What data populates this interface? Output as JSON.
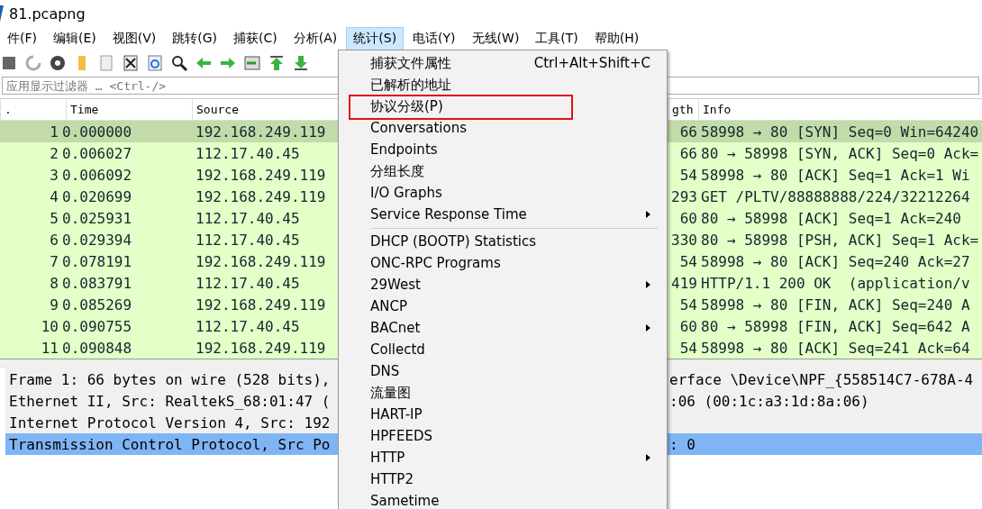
{
  "window": {
    "title": "81.pcapng"
  },
  "menu_bar": [
    {
      "label": "件(F)",
      "selected": false
    },
    {
      "label": "编辑(E)",
      "selected": false
    },
    {
      "label": "视图(V)",
      "selected": false
    },
    {
      "label": "跳转(G)",
      "selected": false
    },
    {
      "label": "捕获(C)",
      "selected": false
    },
    {
      "label": "分析(A)",
      "selected": false
    },
    {
      "label": "统计(S)",
      "selected": true
    },
    {
      "label": "电话(Y)",
      "selected": false
    },
    {
      "label": "无线(W)",
      "selected": false
    },
    {
      "label": "工具(T)",
      "selected": false
    },
    {
      "label": "帮助(H)",
      "selected": false
    }
  ],
  "filter": {
    "placeholder": "应用显示过滤器 … <Ctrl-/>"
  },
  "packet_list": {
    "columns": [
      ".",
      "Time",
      "Source",
      "gth",
      "Info"
    ],
    "rows": [
      {
        "no": "1",
        "time": "0.000000",
        "source": "192.168.249.119",
        "length": "66",
        "info": "58998 → 80 [SYN] Seq=0 Win=64240",
        "selected": true
      },
      {
        "no": "2",
        "time": "0.006027",
        "source": "112.17.40.45",
        "length": "66",
        "info": "80 → 58998 [SYN, ACK] Seq=0 Ack=",
        "selected": false
      },
      {
        "no": "3",
        "time": "0.006092",
        "source": "192.168.249.119",
        "length": "54",
        "info": "58998 → 80 [ACK] Seq=1 Ack=1 Wi",
        "selected": false
      },
      {
        "no": "4",
        "time": "0.020699",
        "source": "192.168.249.119",
        "length": "293",
        "info": "GET /PLTV/88888888/224/32212264",
        "selected": false
      },
      {
        "no": "5",
        "time": "0.025931",
        "source": "112.17.40.45",
        "length": "60",
        "info": "80 → 58998 [ACK] Seq=1 Ack=240 ",
        "selected": false
      },
      {
        "no": "6",
        "time": "0.029394",
        "source": "112.17.40.45",
        "length": "330",
        "info": "80 → 58998 [PSH, ACK] Seq=1 Ack=",
        "selected": false
      },
      {
        "no": "7",
        "time": "0.078191",
        "source": "192.168.249.119",
        "length": "54",
        "info": "58998 → 80 [ACK] Seq=240 Ack=27",
        "selected": false
      },
      {
        "no": "8",
        "time": "0.083791",
        "source": "112.17.40.45",
        "length": "419",
        "info": "HTTP/1.1 200 OK  (application/v",
        "selected": false
      },
      {
        "no": "9",
        "time": "0.085269",
        "source": "192.168.249.119",
        "length": "54",
        "info": "58998 → 80 [FIN, ACK] Seq=240 A",
        "selected": false
      },
      {
        "no": "10",
        "time": "0.090755",
        "source": "112.17.40.45",
        "length": "60",
        "info": "80 → 58998 [FIN, ACK] Seq=642 A",
        "selected": false
      },
      {
        "no": "11",
        "time": "0.090848",
        "source": "192.168.249.119",
        "length": "54",
        "info": "58998 → 80 [ACK] Seq=241 Ack=64",
        "selected": false
      }
    ]
  },
  "details": [
    {
      "left": "Frame 1: 66 bytes on wire (528 bits),",
      "right": "erface \\Device\\NPF_{558514C7-678A-4",
      "selected": false
    },
    {
      "left": "Ethernet II, Src: RealtekS_68:01:47 (",
      "right": ":06 (00:1c:a3:1d:8a:06)",
      "selected": false
    },
    {
      "left": "Internet Protocol Version 4, Src: 192",
      "selected": false
    },
    {
      "left": "Transmission Control Protocol, Src Po",
      "right": ": 0",
      "selected": true
    }
  ],
  "stats_menu": [
    {
      "kind": "item",
      "label": "捕获文件属性",
      "shortcut": "Ctrl+Alt+Shift+C",
      "submenu": false,
      "marked": false
    },
    {
      "kind": "item",
      "label": "已解析的地址",
      "submenu": false,
      "marked": false
    },
    {
      "kind": "item",
      "label": "协议分级(P)",
      "submenu": false,
      "marked": true
    },
    {
      "kind": "item",
      "label": "Conversations",
      "submenu": false,
      "marked": false
    },
    {
      "kind": "item",
      "label": "Endpoints",
      "submenu": false,
      "marked": false
    },
    {
      "kind": "item",
      "label": "分组长度",
      "submenu": false,
      "marked": false
    },
    {
      "kind": "item",
      "label": "I/O Graphs",
      "submenu": false,
      "marked": false
    },
    {
      "kind": "item",
      "label": "Service Response Time",
      "submenu": true,
      "marked": false
    },
    {
      "kind": "separator"
    },
    {
      "kind": "item",
      "label": "DHCP (BOOTP) Statistics",
      "submenu": false,
      "marked": false
    },
    {
      "kind": "item",
      "label": "ONC-RPC Programs",
      "submenu": false,
      "marked": false
    },
    {
      "kind": "item",
      "label": "29West",
      "submenu": true,
      "marked": false
    },
    {
      "kind": "item",
      "label": "ANCP",
      "submenu": false,
      "marked": false
    },
    {
      "kind": "item",
      "label": "BACnet",
      "submenu": true,
      "marked": false
    },
    {
      "kind": "item",
      "label": "Collectd",
      "submenu": false,
      "marked": false
    },
    {
      "kind": "item",
      "label": "DNS",
      "submenu": false,
      "marked": false
    },
    {
      "kind": "item",
      "label": "流量图",
      "submenu": false,
      "marked": false
    },
    {
      "kind": "item",
      "label": "HART-IP",
      "submenu": false,
      "marked": false
    },
    {
      "kind": "item",
      "label": "HPFEEDS",
      "submenu": false,
      "marked": false
    },
    {
      "kind": "item",
      "label": "HTTP",
      "submenu": true,
      "marked": false
    },
    {
      "kind": "item",
      "label": "HTTP2",
      "submenu": false,
      "marked": false
    },
    {
      "kind": "item",
      "label": "Sametime",
      "submenu": false,
      "marked": false
    }
  ]
}
